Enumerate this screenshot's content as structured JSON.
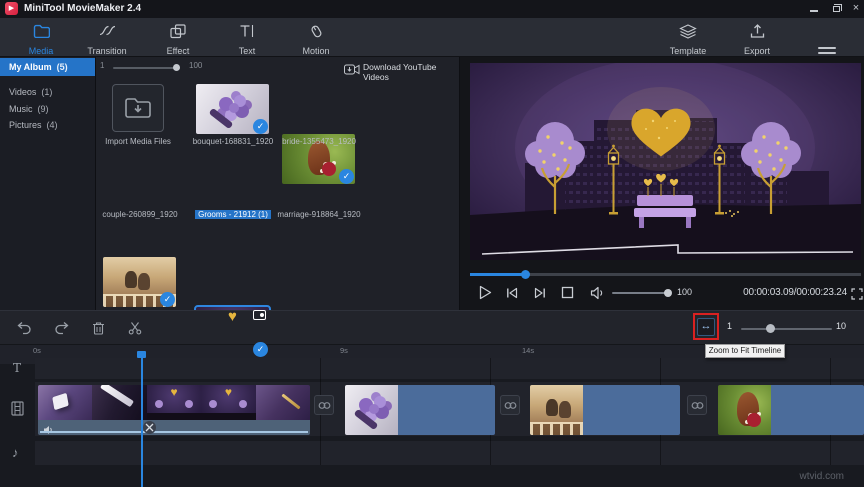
{
  "app": {
    "title": "MiniTool MovieMaker 2.4"
  },
  "icons": {
    "logo_play": "▶",
    "close": "×",
    "check": "✓",
    "heart": "♥",
    "zoom_fit": "↔",
    "text_track": "T",
    "music_note": "♪"
  },
  "tabs": {
    "media": "Media",
    "transition": "Transition",
    "effect": "Effect",
    "text": "Text",
    "motion": "Motion",
    "template": "Template",
    "export": "Export"
  },
  "sidebar": {
    "items": [
      {
        "label": "My Album",
        "count": "(5)"
      },
      {
        "label": "Videos",
        "count": "(1)"
      },
      {
        "label": "Music",
        "count": "(9)"
      },
      {
        "label": "Pictures",
        "count": "(4)"
      }
    ]
  },
  "library": {
    "zoom_min": "1",
    "zoom_max": "100",
    "download_youtube": "Download YouTube Videos",
    "import_label": "Import Media Files",
    "items": [
      {
        "label": "bouquet-168831_1920"
      },
      {
        "label": "bride-1355473_1920"
      },
      {
        "label": "couple-260899_1920"
      },
      {
        "label": "Grooms - 21912 (1)"
      },
      {
        "label": "marriage-918864_1920"
      }
    ]
  },
  "preview": {
    "volume": "100",
    "time": "00:00:03.09/00:00:23.24"
  },
  "timeline_bar": {
    "zoom_min": "1",
    "zoom_max": "10",
    "tooltip": "Zoom to Fit Timeline"
  },
  "timeline": {
    "ticks": [
      {
        "label": "0s"
      },
      {
        "label": "9s"
      },
      {
        "label": "14s"
      }
    ]
  },
  "watermark": "wtvid.com",
  "colors": {
    "accent_blue": "#2a86e0",
    "selection_blue": "#2574c8",
    "clip_blue": "#4b6c9b",
    "annotation_red": "#d92121"
  }
}
